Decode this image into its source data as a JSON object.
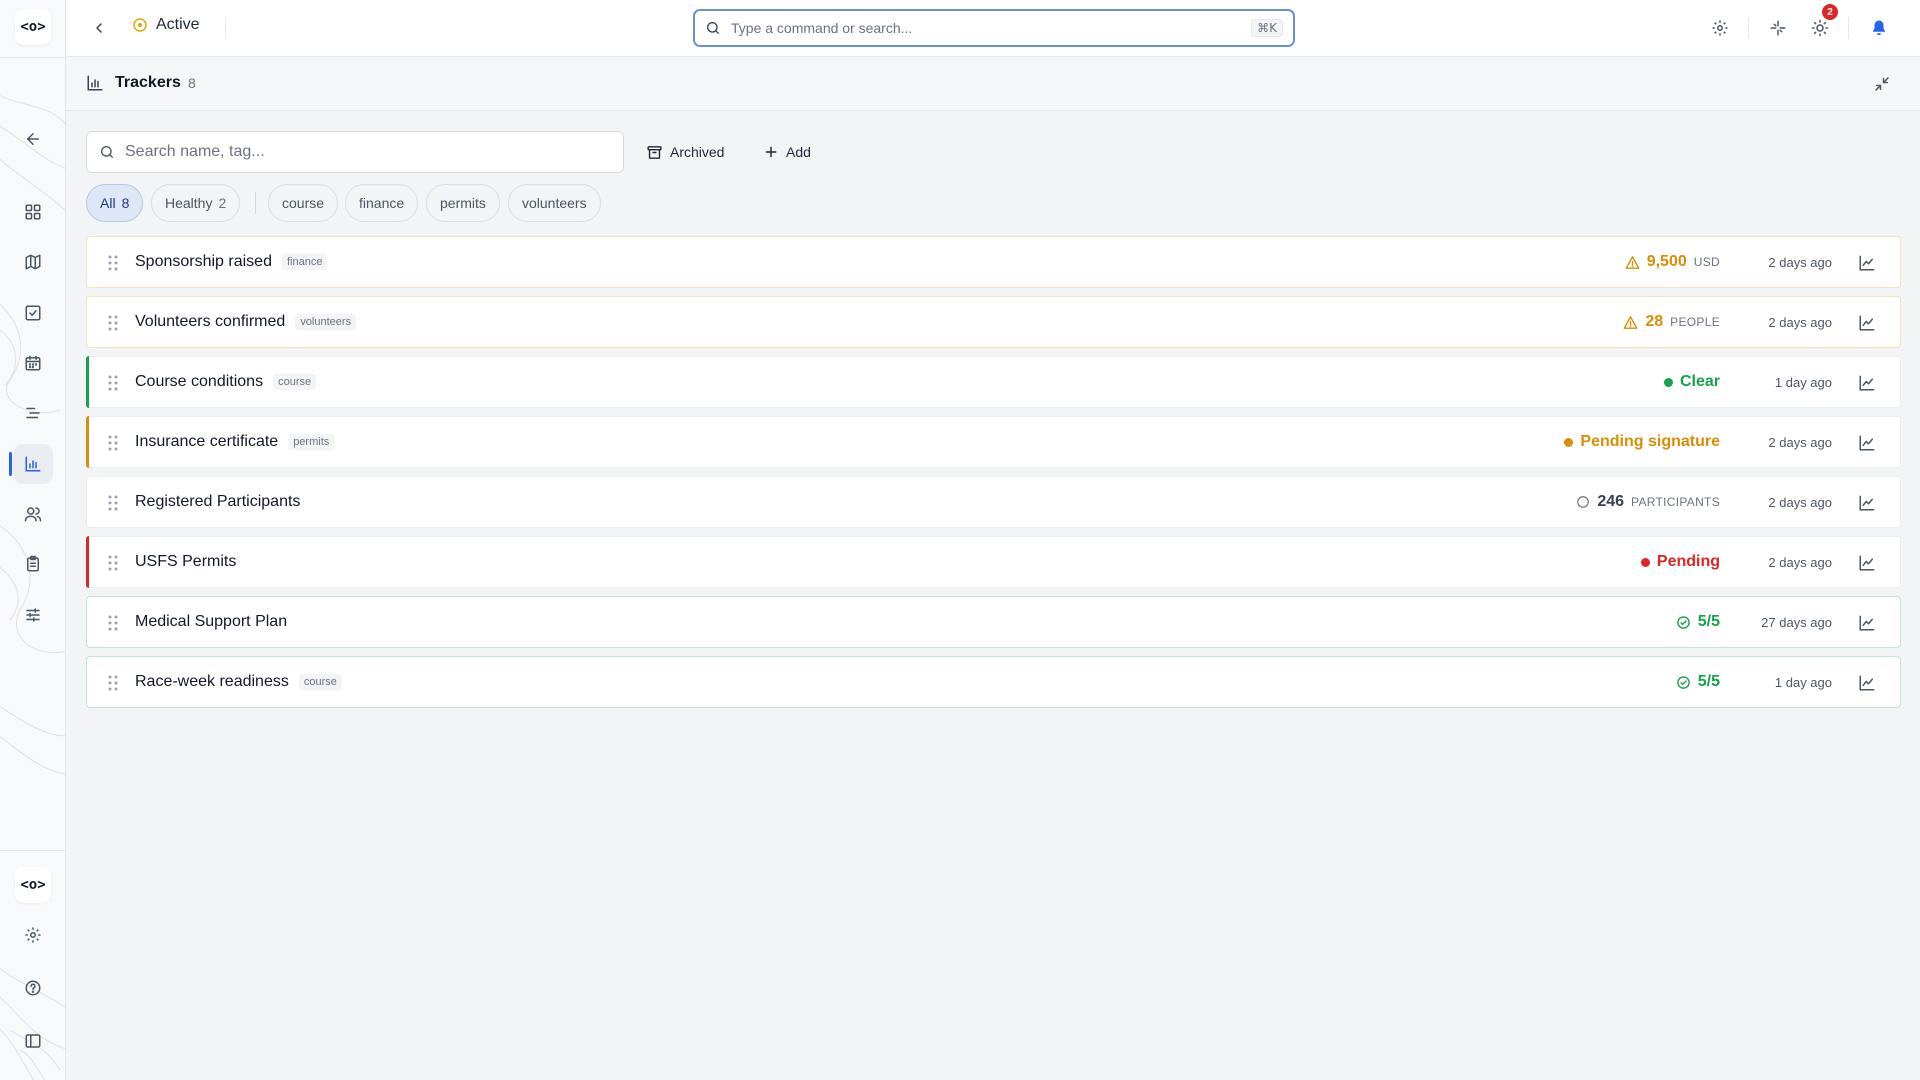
{
  "colors": {
    "accent": "#2563eb",
    "warning": "#d98e05",
    "success": "#16a34a",
    "danger": "#dc2626",
    "neutral": "#374151"
  },
  "topbar": {
    "status_label": "Active",
    "command_placeholder": "Type a command or search...",
    "command_shortcut": "⌘K",
    "notification_count": "2"
  },
  "panel": {
    "title": "Trackers",
    "count": "8"
  },
  "toolbar": {
    "search_placeholder": "Search name, tag...",
    "archived_label": "Archived",
    "add_label": "Add"
  },
  "filters": [
    {
      "label": "All",
      "count": "8"
    },
    {
      "label": "Healthy",
      "count": "2"
    },
    {
      "label": "course"
    },
    {
      "label": "finance"
    },
    {
      "label": "permits"
    },
    {
      "label": "volunteers"
    }
  ],
  "trackers": [
    {
      "name": "Sponsorship raised",
      "tag": "finance",
      "status": "warning",
      "value_icon": "warning-icon",
      "value": "9,500",
      "unit": "USD",
      "updated": "2 days ago"
    },
    {
      "name": "Volunteers confirmed",
      "tag": "volunteers",
      "status": "warning",
      "value_icon": "warning-icon",
      "value": "28",
      "unit": "PEOPLE",
      "updated": "2 days ago"
    },
    {
      "name": "Course conditions",
      "tag": "course",
      "status": "success",
      "value_icon": "status-dot-icon",
      "value": "Clear",
      "unit": "",
      "updated": "1 day ago"
    },
    {
      "name": "Insurance certificate",
      "tag": "permits",
      "status": "warning",
      "value_icon": "status-dot-icon",
      "value": "Pending signature",
      "unit": "",
      "updated": "2 days ago"
    },
    {
      "name": "Registered Participants",
      "tag": "",
      "status": "neutral",
      "value_icon": "empty-circle-icon",
      "value": "246",
      "unit": "PARTICIPANTS",
      "updated": "2 days ago"
    },
    {
      "name": "USFS Permits",
      "tag": "",
      "status": "danger",
      "value_icon": "status-dot-icon",
      "value": "Pending",
      "unit": "",
      "updated": "2 days ago"
    },
    {
      "name": "Medical Support Plan",
      "tag": "",
      "status": "success",
      "value_icon": "check-circle-icon",
      "value": "5/5",
      "unit": "",
      "updated": "27 days ago"
    },
    {
      "name": "Race-week readiness",
      "tag": "course",
      "status": "success",
      "value_icon": "check-circle-icon",
      "value": "5/5",
      "unit": "",
      "updated": "1 day ago"
    }
  ]
}
